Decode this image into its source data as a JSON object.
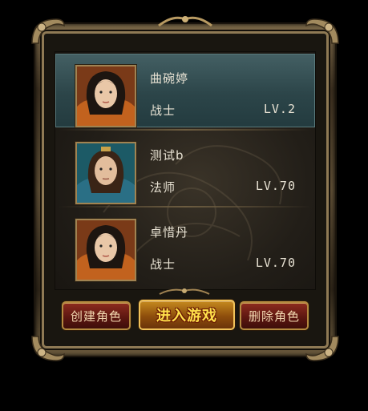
{
  "characters": [
    {
      "name": "曲碗婷",
      "class": "战士",
      "level": "LV.2",
      "selected": true
    },
    {
      "name": "测试b",
      "class": "法师",
      "level": "LV.70",
      "selected": false
    },
    {
      "name": "卓惜丹",
      "class": "战士",
      "level": "LV.70",
      "selected": false
    }
  ],
  "buttons": {
    "create": "创建角色",
    "enter": "进入游戏",
    "delete": "删除角色"
  },
  "colors": {
    "selected_row": "#2c4549",
    "frame_gold": "#8f7a55",
    "enter_button": "#c58a1f",
    "enter_text": "#ffe04a",
    "red_button": "#8e2c1f"
  }
}
